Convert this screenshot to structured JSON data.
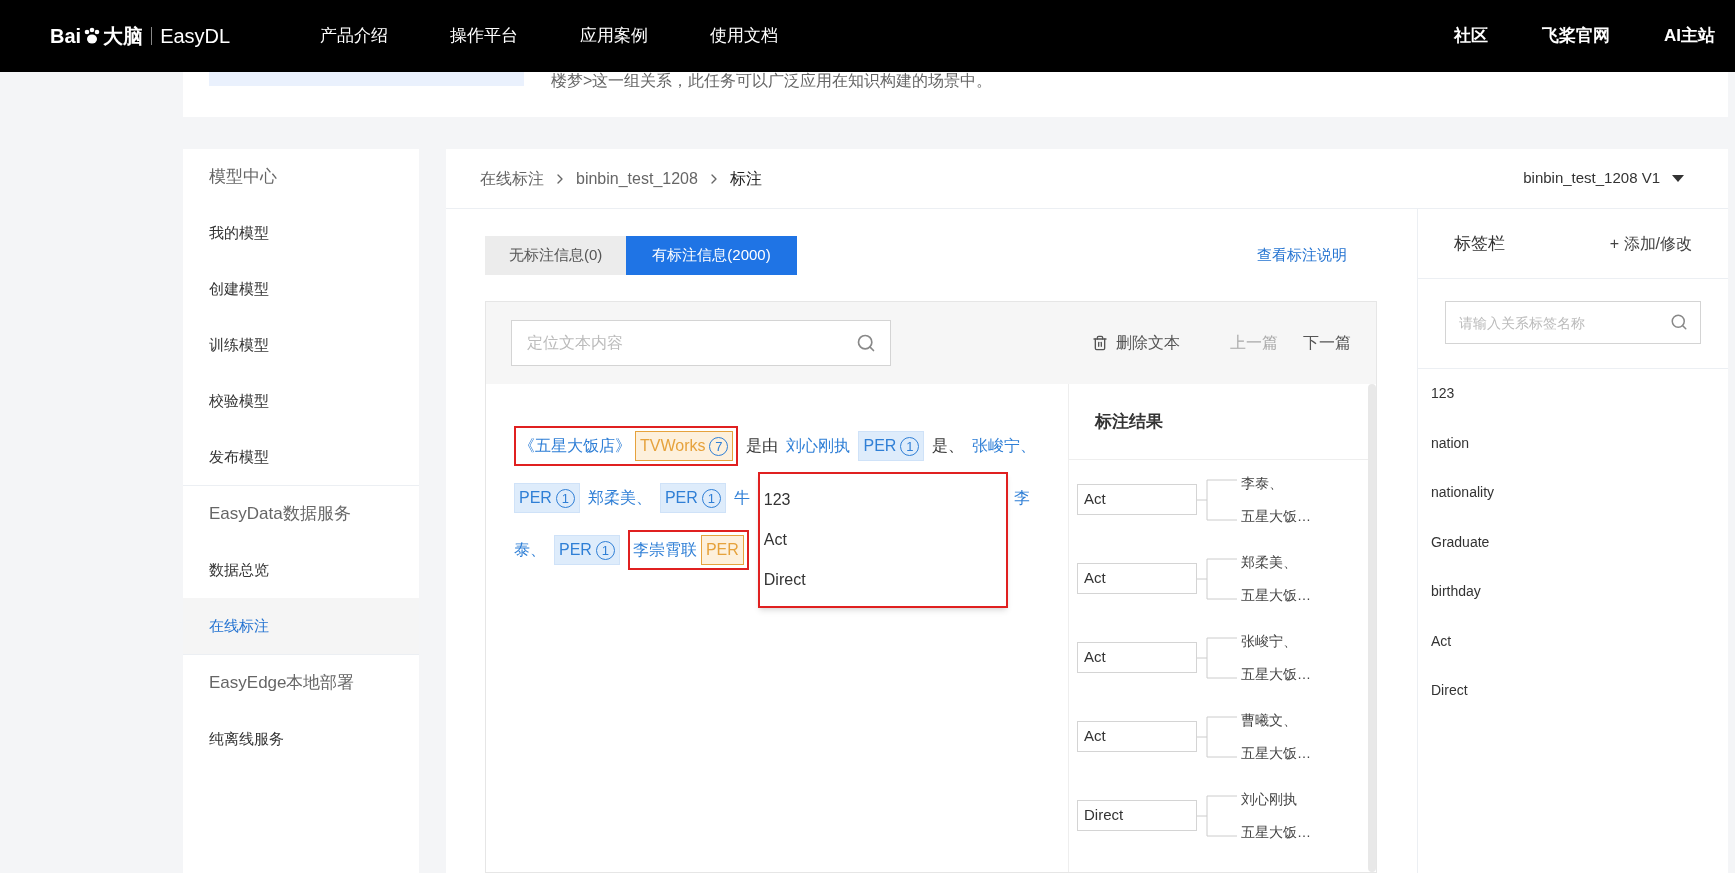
{
  "header": {
    "logo_text": "Bai",
    "logo_suffix": "大脑",
    "product": "EasyDL",
    "nav": [
      "产品介绍",
      "操作平台",
      "应用案例",
      "使用文档"
    ],
    "right_links": [
      "社区",
      "飞桨官网",
      "AI主站"
    ]
  },
  "intro": {
    "text": "楼梦>这一组关系，此任务可以广泛应用在知识构建的场景中。"
  },
  "sidebar": {
    "sections": [
      {
        "title": "模型中心",
        "items": [
          {
            "label": "我的模型",
            "selected": false
          },
          {
            "label": "创建模型",
            "selected": false
          },
          {
            "label": "训练模型",
            "selected": false
          },
          {
            "label": "校验模型",
            "selected": false
          },
          {
            "label": "发布模型",
            "selected": false
          }
        ]
      },
      {
        "title": "EasyData数据服务",
        "items": [
          {
            "label": "数据总览",
            "selected": false
          },
          {
            "label": "在线标注",
            "selected": true
          }
        ]
      },
      {
        "title": "EasyEdge本地部署",
        "items": [
          {
            "label": "纯离线服务",
            "selected": false
          }
        ]
      }
    ]
  },
  "breadcrumb": [
    "在线标注",
    "binbin_test_1208",
    "标注"
  ],
  "version_select": {
    "value": "binbin_test_1208 V1"
  },
  "tabs": [
    {
      "label": "无标注信息(0)",
      "selected": false
    },
    {
      "label": "有标注信息(2000)",
      "selected": true
    }
  ],
  "guide_link": "查看标注说明",
  "toolbar": {
    "search": {
      "placeholder": "定位文本内容"
    },
    "delete": "删除文本",
    "prev": "上一篇",
    "next": "下一篇"
  },
  "annotation": {
    "line_1": [
      {
        "kind": "group",
        "items": [
          {
            "kind": "entity",
            "text": "《五星大饭店》"
          },
          {
            "kind": "tag",
            "label": "TVWorks",
            "count": "7",
            "selected": true
          }
        ]
      },
      {
        "kind": "text",
        "text": "是由"
      },
      {
        "kind": "entity",
        "text": "刘心刚执"
      },
      {
        "kind": "tag",
        "label": "PER",
        "count": "1",
        "selected": false
      },
      {
        "kind": "text",
        "text": "是、"
      },
      {
        "kind": "entity",
        "text": "张峻宁、"
      }
    ],
    "line_2": [
      {
        "kind": "tag",
        "label": "PER",
        "count": "1",
        "selected": false
      },
      {
        "kind": "entity",
        "text": "郑柔美、"
      },
      {
        "kind": "tag",
        "label": "PER",
        "count": "1",
        "selected": false
      },
      {
        "kind": "entity",
        "text": "牛"
      }
    ],
    "line_2_tail": [
      {
        "kind": "entity",
        "text": "李"
      }
    ],
    "line_3": [
      {
        "kind": "entity",
        "text": "泰、"
      },
      {
        "kind": "tag",
        "label": "PER",
        "count": "1",
        "selected": false
      },
      {
        "kind": "group",
        "items": [
          {
            "kind": "entity",
            "text": "李崇霄联"
          },
          {
            "kind": "tag",
            "label": "PER",
            "selected": true
          }
        ]
      }
    ],
    "dropdown": [
      "123",
      "Act",
      "Direct"
    ]
  },
  "results": {
    "title": "标注结果",
    "rows": [
      {
        "relation": "Act",
        "subject": "李泰、",
        "object": "五星大饭…"
      },
      {
        "relation": "Act",
        "subject": "郑柔美、",
        "object": "五星大饭…"
      },
      {
        "relation": "Act",
        "subject": "张峻宁、",
        "object": "五星大饭…"
      },
      {
        "relation": "Act",
        "subject": "曹曦文、",
        "object": "五星大饭…"
      },
      {
        "relation": "Direct",
        "subject": "刘心刚执",
        "object": "五星大饭…"
      }
    ]
  },
  "tag_panel": {
    "title": "标签栏",
    "action": "+ 添加/修改",
    "search": {
      "placeholder": "请输入关系标签名称"
    },
    "tags": [
      "123",
      "nation",
      "nationality",
      "Graduate",
      "birthday",
      "Act",
      "Direct"
    ]
  }
}
